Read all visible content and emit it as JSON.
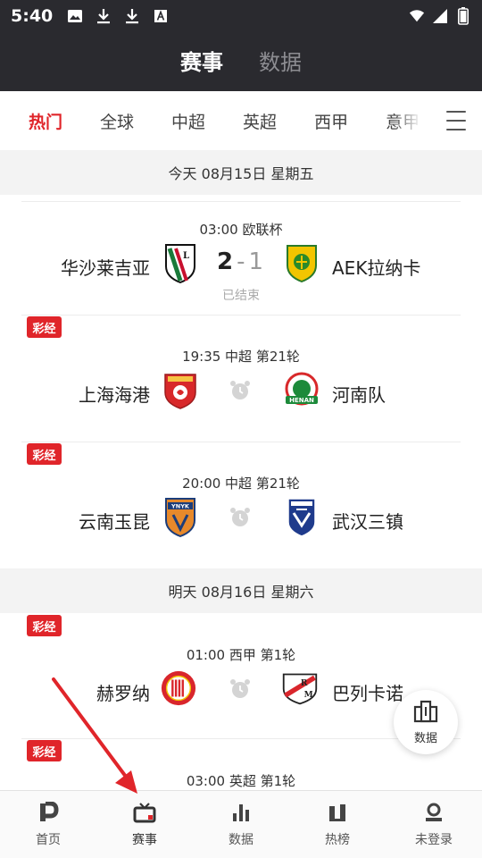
{
  "status_bar": {
    "time": "5:40",
    "left_icons": [
      "image-icon",
      "download-icon",
      "download-icon",
      "font-icon"
    ],
    "right_icons": [
      "wifi-icon",
      "signal-icon",
      "battery-icon"
    ]
  },
  "top_tabs": [
    {
      "label": "赛事",
      "active": true
    },
    {
      "label": "数据",
      "active": false
    }
  ],
  "categories": [
    {
      "label": "热门",
      "active": true
    },
    {
      "label": "全球",
      "active": false
    },
    {
      "label": "中超",
      "active": false
    },
    {
      "label": "英超",
      "active": false
    },
    {
      "label": "西甲",
      "active": false
    },
    {
      "label": "意甲",
      "active": false
    }
  ],
  "date_headers": [
    "今天 08月15日 星期五",
    "明天 08月16日 星期六"
  ],
  "matches": [
    {
      "badge": "",
      "meta": "03:00  欧联杯",
      "home": "华沙莱吉亚",
      "away": "AEK拉纳卡",
      "home_score": "2",
      "away_score": "1",
      "status": "已结束",
      "home_logo": "legia-warsaw-logo",
      "away_logo": "aek-larnaca-logo"
    },
    {
      "badge": "彩经",
      "meta": "19:35  中超  第21轮",
      "home": "上海海港",
      "away": "河南队",
      "status": "",
      "home_logo": "shanghai-port-logo",
      "away_logo": "henan-logo"
    },
    {
      "badge": "彩经",
      "meta": "20:00  中超  第21轮",
      "home": "云南玉昆",
      "away": "武汉三镇",
      "status": "",
      "home_logo": "yunnan-yukun-logo",
      "away_logo": "wuhan-three-towns-logo"
    },
    {
      "badge": "彩经",
      "meta": "01:00  西甲  第1轮",
      "home": "赫罗纳",
      "away": "巴列卡诺",
      "status": "",
      "home_logo": "girona-logo",
      "away_logo": "rayo-vallecano-logo"
    },
    {
      "badge": "彩经",
      "meta": "03:00  英超  第1轮",
      "home": "",
      "away": "",
      "status": ""
    }
  ],
  "fab": {
    "label": "数据",
    "icon": "data-chart-icon"
  },
  "bottom_nav": [
    {
      "label": "首页",
      "icon": "home-p-icon",
      "active": false
    },
    {
      "label": "赛事",
      "icon": "tv-icon",
      "active": true
    },
    {
      "label": "数据",
      "icon": "bar-chart-icon",
      "active": false
    },
    {
      "label": "热榜",
      "icon": "ranking-icon",
      "active": false
    },
    {
      "label": "未登录",
      "icon": "user-icon",
      "active": false
    }
  ],
  "colors": {
    "accent": "#e0252a",
    "header_bg": "#2a2a2f",
    "annotation_arrow": "#e0252a"
  }
}
